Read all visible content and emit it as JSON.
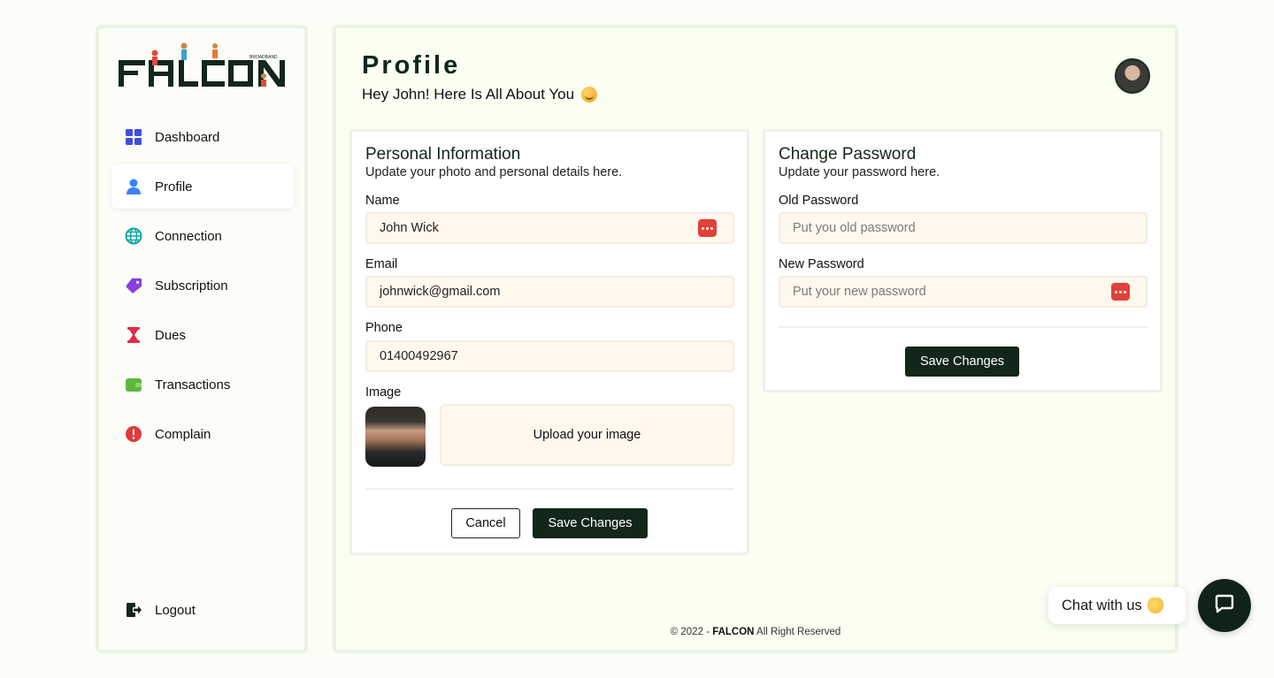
{
  "brand": {
    "name": "FALCON",
    "tagline": "BROADBAND"
  },
  "sidebar": {
    "items": [
      {
        "label": "Dashboard",
        "icon": "dashboard-grid-icon",
        "color": "#3b4fe0"
      },
      {
        "label": "Profile",
        "icon": "user-icon",
        "color": "#3b82f6",
        "active": true
      },
      {
        "label": "Connection",
        "icon": "globe-icon",
        "color": "#11a7a5"
      },
      {
        "label": "Subscription",
        "icon": "tag-icon",
        "color": "#8b3fe0"
      },
      {
        "label": "Dues",
        "icon": "hourglass-icon",
        "color": "#e02a4a"
      },
      {
        "label": "Transactions",
        "icon": "wallet-icon",
        "color": "#5cb83c"
      },
      {
        "label": "Complain",
        "icon": "alert-circle-icon",
        "color": "#e03a3a"
      }
    ],
    "logout": {
      "label": "Logout",
      "icon": "logout-icon"
    }
  },
  "header": {
    "title": "Profile",
    "subtitle": "Hey John! Here Is All About You",
    "avatar_icon": "user-avatar"
  },
  "personal": {
    "title": "Personal Information",
    "description": "Update your photo and personal details here.",
    "name_label": "Name",
    "name_value": "John Wick",
    "email_label": "Email",
    "email_value": "johnwick@gmail.com",
    "phone_label": "Phone",
    "phone_value": "01400492967",
    "image_label": "Image",
    "upload_label": "Upload your image",
    "cancel_label": "Cancel",
    "save_label": "Save Changes"
  },
  "password": {
    "title": "Change Password",
    "description": "Update your password here.",
    "old_label": "Old Password",
    "old_placeholder": "Put you old password",
    "new_label": "New Password",
    "new_placeholder": "Put your new password",
    "save_label": "Save Changes"
  },
  "footer": {
    "prefix": "© 2022 - ",
    "brand": "FALCON",
    "suffix": " All Right Reserved"
  },
  "chat": {
    "label": "Chat with us",
    "icon": "chat-bubble-icon"
  },
  "colors": {
    "primary_dark": "#12261a",
    "field_bg": "#fff8ec",
    "card_border": "#eef1ea"
  }
}
